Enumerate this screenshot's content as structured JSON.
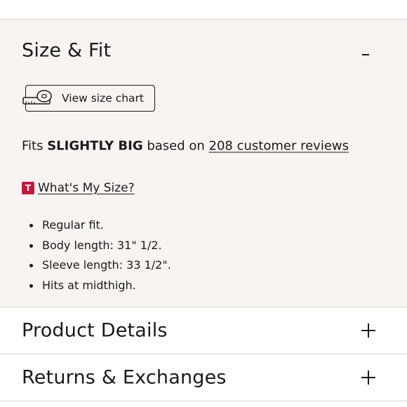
{
  "size_fit": {
    "title": "Size & Fit",
    "view_size_chart_label": "View size chart",
    "fits_prefix": "Fits ",
    "fits_value": "SLIGHTLY BIG",
    "fits_middle": " based on ",
    "reviews_link": "208 customer reviews",
    "whats_my_size_badge": "T",
    "whats_my_size_label": "What's My Size?",
    "fit_notes": [
      "Regular fit.",
      "Body length: 31\" 1/2.",
      "Sleeve length: 33 1/2\".",
      "Hits at midthigh."
    ]
  },
  "sections": [
    {
      "title": "Product Details"
    },
    {
      "title": "Returns & Exchanges"
    }
  ],
  "colors": {
    "panel_background": "#f8f4f1",
    "badge_red": "#c8163f",
    "divider": "#d9d6d2"
  },
  "icons": {
    "tape_measure": "tape-measure-icon",
    "collapse": "minus-icon",
    "expand": "plus-icon"
  }
}
